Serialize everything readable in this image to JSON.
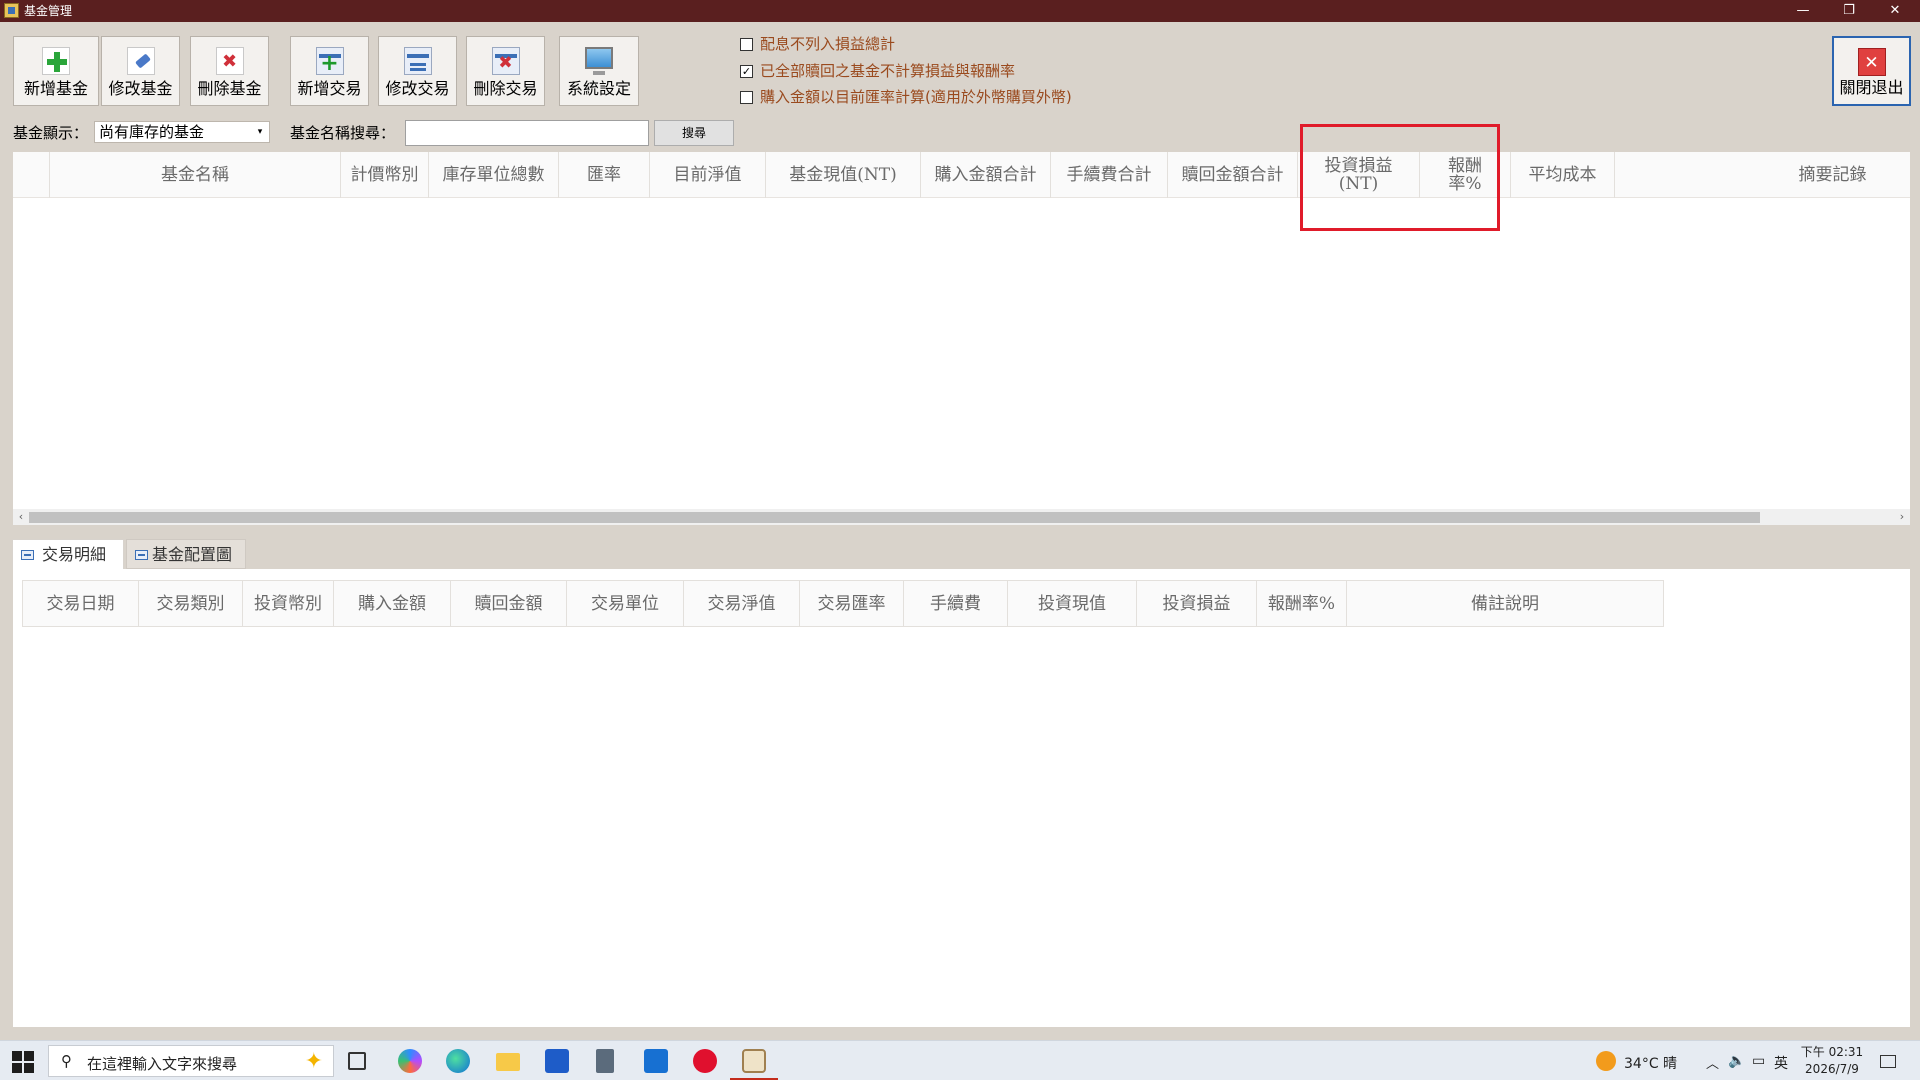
{
  "window": {
    "title": "基金管理",
    "minimize": "—",
    "restore": "❐",
    "close": "✕"
  },
  "toolbar": {
    "buttons": [
      {
        "label": "新增基金",
        "icon": "add-fund-icon"
      },
      {
        "label": "修改基金",
        "icon": "edit-fund-icon"
      },
      {
        "label": "刪除基金",
        "icon": "delete-fund-icon"
      },
      {
        "label": "新增交易",
        "icon": "add-transaction-icon"
      },
      {
        "label": "修改交易",
        "icon": "edit-transaction-icon"
      },
      {
        "label": "刪除交易",
        "icon": "delete-transaction-icon"
      },
      {
        "label": "系統設定",
        "icon": "monitor-icon"
      }
    ],
    "exit_label": "關閉退出"
  },
  "options": [
    {
      "label": "配息不列入損益總計",
      "checked": false
    },
    {
      "label": "已全部贖回之基金不計算損益與報酬率",
      "checked": true
    },
    {
      "label": "購入金額以目前匯率計算(適用於外幣購買外幣)",
      "checked": false
    }
  ],
  "filter": {
    "display_label": "基金顯示：",
    "display_value": "尚有庫存的基金",
    "search_label": "基金名稱搜尋：",
    "search_value": "",
    "search_button": "搜尋"
  },
  "fund_grid": {
    "columns": [
      "",
      "基金名稱",
      "計價幣別",
      "庫存單位總數",
      "匯率",
      "目前淨值",
      "基金現值(NT)",
      "購入金額合計",
      "手續費合計",
      "贖回金額合計",
      "投資損益\n(NT)",
      "報酬\n率%",
      "平均成本",
      "",
      "摘要記錄"
    ],
    "rows": []
  },
  "tabs": [
    {
      "label": "交易明細",
      "active": true
    },
    {
      "label": "基金配置圖",
      "active": false
    }
  ],
  "transaction_grid": {
    "columns": [
      "交易日期",
      "交易類別",
      "投資幣別",
      "購入金額",
      "贖回金額",
      "交易單位",
      "交易淨值",
      "交易匯率",
      "手續費",
      "投資現值",
      "投資損益",
      "報酬率%",
      "備註說明"
    ],
    "rows": []
  },
  "taskbar": {
    "search_placeholder": "在這裡輸入文字來搜尋",
    "weather": "34°C 晴",
    "ime": "英",
    "time": "下午 02:31",
    "date": "2026/7/9"
  },
  "colors": {
    "titlebar": "#5a1f1f",
    "option_text": "#9a4a1e",
    "highlight": "#e01b2a"
  }
}
